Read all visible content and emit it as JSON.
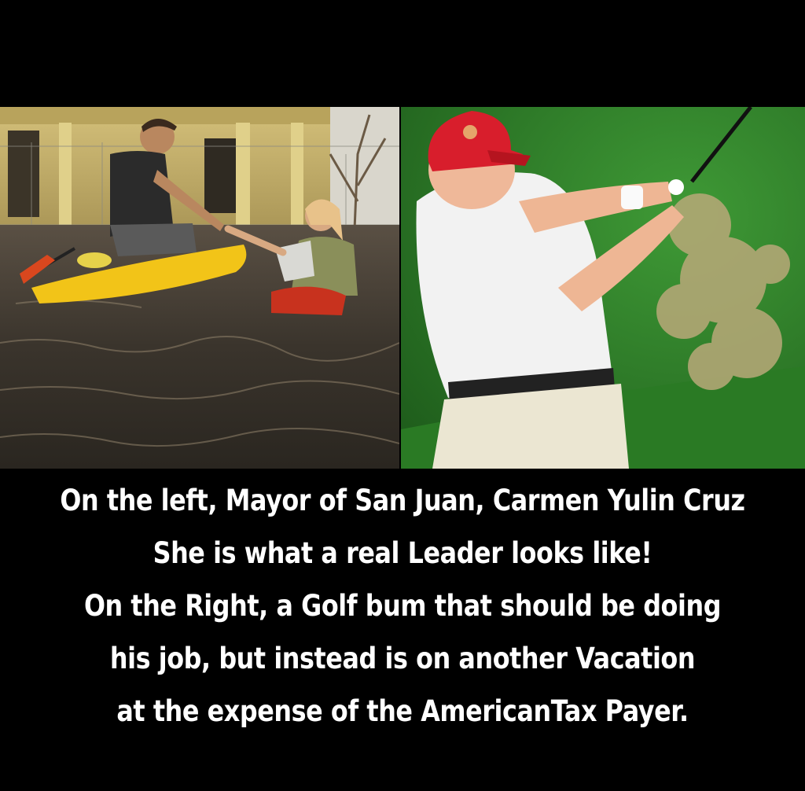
{
  "caption": {
    "lines": [
      "On the left, Mayor of San Juan, Carmen Yulin Cruz",
      "She is what a real Leader looks like!",
      "On the Right, a Golf bum that should be doing",
      "his job, but instead is on another Vacation",
      "at the expense of the AmericanTax Payer."
    ]
  },
  "colors": {
    "background": "#000000",
    "caption_text": "#ffffff",
    "floodwater": "#3a342c",
    "kayak": "#f2c418",
    "building": "#c9b469",
    "golf_green": "#2f7d2a",
    "cap_red": "#d81e2c",
    "shirt_white": "#f2f2f2"
  }
}
